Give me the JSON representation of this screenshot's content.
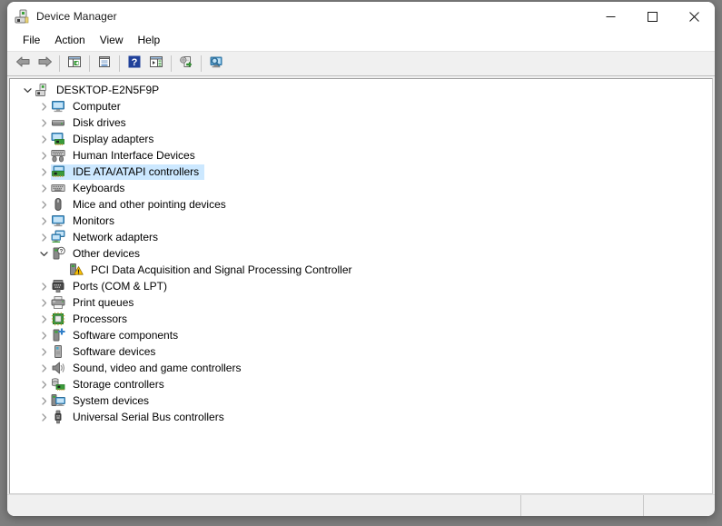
{
  "window": {
    "title": "Device Manager",
    "icon": "device-manager-icon",
    "controls": {
      "minimize": "Minimize",
      "maximize": "Maximize",
      "close": "Close"
    }
  },
  "menubar": {
    "items": [
      {
        "label": "File"
      },
      {
        "label": "Action"
      },
      {
        "label": "View"
      },
      {
        "label": "Help"
      }
    ]
  },
  "toolbar": {
    "buttons": [
      {
        "name": "back-button",
        "icon": "back-arrow-icon"
      },
      {
        "name": "forward-button",
        "icon": "forward-arrow-icon"
      },
      {
        "name": "show-hide-console-tree-button",
        "icon": "console-tree-icon"
      },
      {
        "name": "properties-button",
        "icon": "properties-icon"
      },
      {
        "name": "help-button",
        "icon": "help-question-icon"
      },
      {
        "name": "show-hide-action-pane-button",
        "icon": "action-pane-icon"
      },
      {
        "name": "update-driver-button",
        "icon": "update-driver-icon"
      },
      {
        "name": "scan-for-hardware-changes-button",
        "icon": "scan-hardware-icon"
      }
    ]
  },
  "tree": {
    "root": {
      "label": "DESKTOP-E2N5F9P",
      "icon": "computer-root-icon",
      "expanded": true,
      "selected": false
    },
    "items": [
      {
        "label": "Computer",
        "icon": "computer-icon",
        "expanded": false,
        "selected": false,
        "level": 1
      },
      {
        "label": "Disk drives",
        "icon": "disk-drive-icon",
        "expanded": false,
        "selected": false,
        "level": 1
      },
      {
        "label": "Display adapters",
        "icon": "display-adapter-icon",
        "expanded": false,
        "selected": false,
        "level": 1
      },
      {
        "label": "Human Interface Devices",
        "icon": "hid-icon",
        "expanded": false,
        "selected": false,
        "level": 1
      },
      {
        "label": "IDE ATA/ATAPI controllers",
        "icon": "ide-controller-icon",
        "expanded": false,
        "selected": true,
        "level": 1
      },
      {
        "label": "Keyboards",
        "icon": "keyboard-icon",
        "expanded": false,
        "selected": false,
        "level": 1
      },
      {
        "label": "Mice and other pointing devices",
        "icon": "mouse-icon",
        "expanded": false,
        "selected": false,
        "level": 1
      },
      {
        "label": "Monitors",
        "icon": "monitor-icon",
        "expanded": false,
        "selected": false,
        "level": 1
      },
      {
        "label": "Network adapters",
        "icon": "network-adapter-icon",
        "expanded": false,
        "selected": false,
        "level": 1
      },
      {
        "label": "Other devices",
        "icon": "other-device-icon",
        "expanded": true,
        "selected": false,
        "level": 1
      },
      {
        "label": "PCI Data Acquisition and Signal Processing Controller",
        "icon": "unknown-device-warning-icon",
        "expanded": null,
        "selected": false,
        "level": 2
      },
      {
        "label": "Ports (COM & LPT)",
        "icon": "port-icon",
        "expanded": false,
        "selected": false,
        "level": 1
      },
      {
        "label": "Print queues",
        "icon": "printer-icon",
        "expanded": false,
        "selected": false,
        "level": 1
      },
      {
        "label": "Processors",
        "icon": "processor-icon",
        "expanded": false,
        "selected": false,
        "level": 1
      },
      {
        "label": "Software components",
        "icon": "software-component-icon",
        "expanded": false,
        "selected": false,
        "level": 1
      },
      {
        "label": "Software devices",
        "icon": "software-device-icon",
        "expanded": false,
        "selected": false,
        "level": 1
      },
      {
        "label": "Sound, video and game controllers",
        "icon": "sound-controller-icon",
        "expanded": false,
        "selected": false,
        "level": 1
      },
      {
        "label": "Storage controllers",
        "icon": "storage-controller-icon",
        "expanded": false,
        "selected": false,
        "level": 1
      },
      {
        "label": "System devices",
        "icon": "system-device-icon",
        "expanded": false,
        "selected": false,
        "level": 1
      },
      {
        "label": "Universal Serial Bus controllers",
        "icon": "usb-controller-icon",
        "expanded": false,
        "selected": false,
        "level": 1
      }
    ]
  },
  "statusbar": {
    "pane1": "",
    "pane2": "",
    "pane3": ""
  },
  "colors": {
    "selection": "#cce8ff",
    "window_bg": "#ffffff",
    "chrome_bg": "#f0f0f0",
    "warning": "#ffc300"
  }
}
